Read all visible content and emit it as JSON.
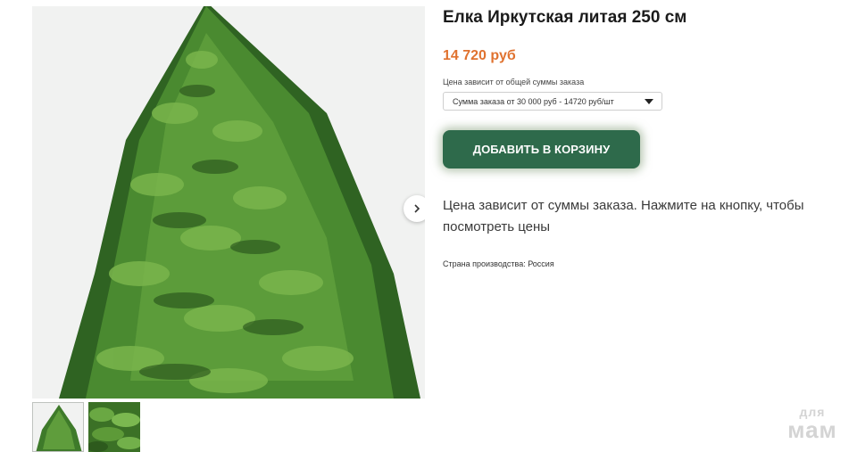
{
  "product": {
    "title": "Елка Иркутская литая 250 см",
    "price": "14 720 руб",
    "price_note": "Цена зависит от общей суммы заказа",
    "price_option_selected": "Сумма заказа от 30 000 руб - 14720 руб/шт",
    "add_to_cart_label": "ДОБАВИТЬ В КОРЗИНУ",
    "description": "Цена зависит от суммы заказа. Нажмите на кнопку, чтобы посмотреть цены",
    "country_of_origin": "Страна производства: Россия"
  },
  "gallery": {
    "next_icon": "chevron-right-icon",
    "thumbnails": [
      "tree-full-thumbnail",
      "branch-closeup-thumbnail"
    ]
  },
  "watermark": {
    "line1": "для",
    "line2": "мам"
  },
  "colors": {
    "price": "#e0722f",
    "button": "#2e6a4b",
    "tree": "#3f7a2a"
  }
}
